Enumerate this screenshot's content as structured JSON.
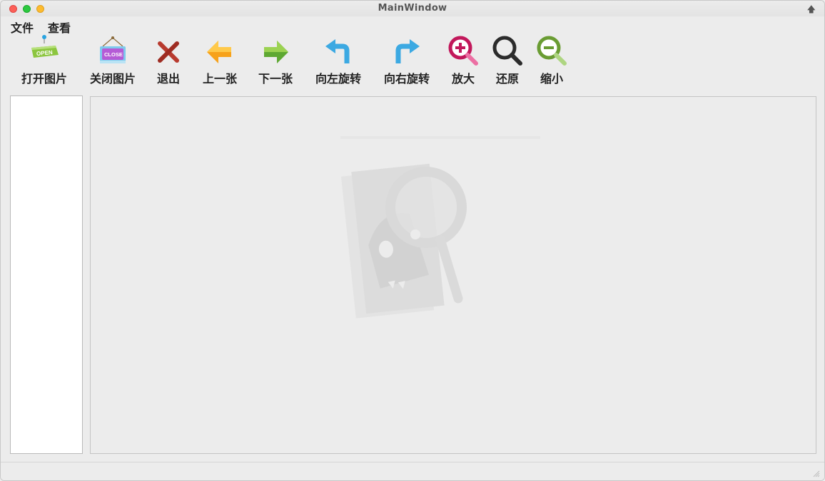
{
  "window": {
    "title": "MainWindow"
  },
  "menu": {
    "items": [
      "文件",
      "查看"
    ]
  },
  "toolbar": {
    "open": "打开图片",
    "close": "关闭图片",
    "quit": "退出",
    "prev": "上一张",
    "next": "下一张",
    "rotate_left": "向左旋转",
    "rotate_right": "向右旋转",
    "zoom_in": "放大",
    "restore": "还原",
    "zoom_out": "缩小"
  },
  "icons": {
    "open_sign_text": "OPEN",
    "close_sign_text": "CLOSE",
    "open_sign_color": "#8cc63f",
    "close_sign_color": "#b55bd6",
    "quit_color": "#b83a2e",
    "prev_color": "#f7a21b",
    "next_color": "#7ac143",
    "rotate_color": "#3ca9e2",
    "zoom_in_color": "#c2185b",
    "restore_color": "#2b2b2b",
    "zoom_out_color": "#7cb342"
  }
}
